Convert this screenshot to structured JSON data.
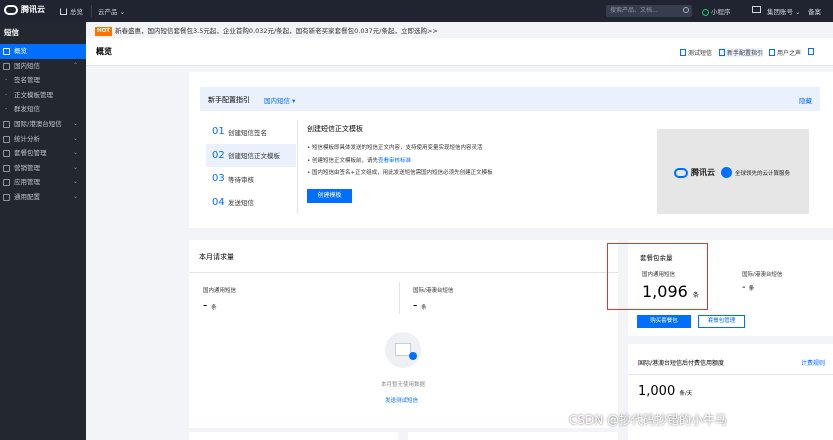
{
  "topbar": {
    "brand": "腾讯云",
    "home": "总览",
    "products": "云产品 ⌄",
    "search_placeholder": "搜索产品、文档...",
    "miniprogram": "小程序",
    "links": [
      "集团账号 ⌄",
      "备案"
    ]
  },
  "notice": {
    "badge": "HOT",
    "text": "新春盛惠，国内短信套餐包3.5元起，企业首购0.032元/条起，国有新老买家套餐包0.037元/条起，立即选购>>"
  },
  "sidebar": {
    "title": "短信",
    "items": [
      {
        "label": "概览",
        "active": true,
        "arrow": ""
      },
      {
        "label": "国内短信",
        "arrow": "⌃"
      },
      {
        "label": "签名管理",
        "sub": true,
        "arrow": ""
      },
      {
        "label": "正文模板管理",
        "sub": true,
        "arrow": ""
      },
      {
        "label": "群发短信",
        "sub": true,
        "arrow": ""
      },
      {
        "label": "国际/港澳台短信",
        "arrow": "⌄"
      },
      {
        "label": "统计分析",
        "arrow": "⌄"
      },
      {
        "label": "套餐包管理",
        "arrow": "⌄"
      },
      {
        "label": "营销管理",
        "arrow": "⌄"
      },
      {
        "label": "应用管理",
        "arrow": "⌄"
      },
      {
        "label": "通用配置",
        "arrow": "⌄"
      }
    ]
  },
  "header": {
    "title": "概览",
    "buttons": [
      "测试短信",
      "新手配置指引",
      "用户之声"
    ]
  },
  "guide": {
    "title": "新手配置指引",
    "selector": "国内短信 ▾",
    "hide": "隐藏",
    "steps": [
      {
        "num": "01",
        "label": "创建短信签名"
      },
      {
        "num": "02",
        "label": "创建短信正文模板"
      },
      {
        "num": "03",
        "label": "等待审核"
      },
      {
        "num": "04",
        "label": "发送短信"
      }
    ],
    "content_title": "创建短信正文模板",
    "content_items": [
      {
        "text": "短信模板即具体发送的短信正文内容，支持使用变量实现短信内容灵活",
        "link": ""
      },
      {
        "text": "创建短信正文模板前，请先",
        "link": "查看审核标准"
      },
      {
        "text": "国内短信由签名+正文组成，用此发送短信需国内短信必须先创建正文模板",
        "link": ""
      }
    ],
    "create_button": "创建模板",
    "banner_brand": "腾讯云",
    "banner_slogan": "全球领先的云计算服务"
  },
  "requests": {
    "title": "本月请求量",
    "col1_label": "国内通用短信",
    "col1_value": "-",
    "col1_unit": "条",
    "col2_label": "国际/港澳台短信",
    "col2_value": "-",
    "col2_unit": "条",
    "empty_text": "本月暂无使用数据",
    "empty_link": "发送测试短信"
  },
  "package": {
    "title": "套餐包余量",
    "col1_label": "国内通用短信",
    "col1_value": "1,096",
    "col1_unit": "条",
    "col2_label": "国际/港澳台短信",
    "col2_value": "-",
    "col2_unit": "条",
    "buy_button": "购买套餐包",
    "manage_button": "套餐包管理"
  },
  "intl": {
    "title": "国际/港澳台短信后付费信用额度",
    "link": "计费规则",
    "value": "1,000",
    "unit": "条/天"
  },
  "watermark": "CSDN @抄代码抄错的小牛马",
  "colors": {
    "accent": "#006eff",
    "topbar": "#1f2430",
    "sidebar": "#23272f",
    "highlight_box": "#e23434"
  }
}
